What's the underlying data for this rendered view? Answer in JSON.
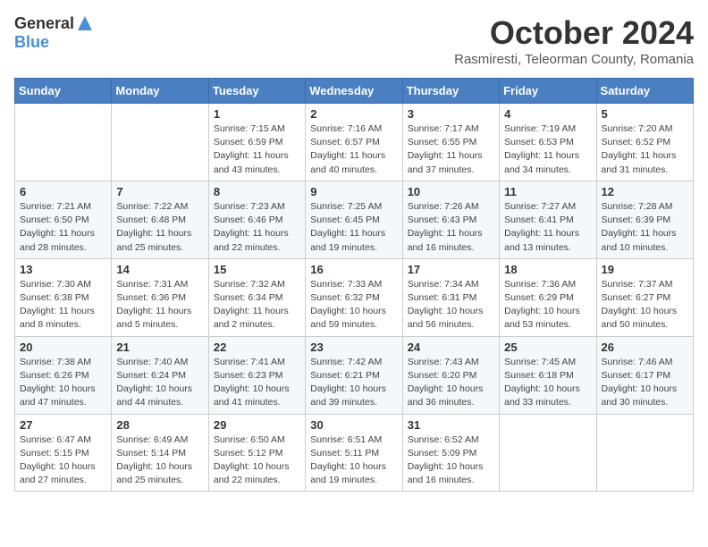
{
  "logo": {
    "general": "General",
    "blue": "Blue"
  },
  "title": "October 2024",
  "location": "Rasmiresti, Teleorman County, Romania",
  "weekdays": [
    "Sunday",
    "Monday",
    "Tuesday",
    "Wednesday",
    "Thursday",
    "Friday",
    "Saturday"
  ],
  "weeks": [
    [
      {
        "day": "",
        "detail": ""
      },
      {
        "day": "",
        "detail": ""
      },
      {
        "day": "1",
        "detail": "Sunrise: 7:15 AM\nSunset: 6:59 PM\nDaylight: 11 hours and 43 minutes."
      },
      {
        "day": "2",
        "detail": "Sunrise: 7:16 AM\nSunset: 6:57 PM\nDaylight: 11 hours and 40 minutes."
      },
      {
        "day": "3",
        "detail": "Sunrise: 7:17 AM\nSunset: 6:55 PM\nDaylight: 11 hours and 37 minutes."
      },
      {
        "day": "4",
        "detail": "Sunrise: 7:19 AM\nSunset: 6:53 PM\nDaylight: 11 hours and 34 minutes."
      },
      {
        "day": "5",
        "detail": "Sunrise: 7:20 AM\nSunset: 6:52 PM\nDaylight: 11 hours and 31 minutes."
      }
    ],
    [
      {
        "day": "6",
        "detail": "Sunrise: 7:21 AM\nSunset: 6:50 PM\nDaylight: 11 hours and 28 minutes."
      },
      {
        "day": "7",
        "detail": "Sunrise: 7:22 AM\nSunset: 6:48 PM\nDaylight: 11 hours and 25 minutes."
      },
      {
        "day": "8",
        "detail": "Sunrise: 7:23 AM\nSunset: 6:46 PM\nDaylight: 11 hours and 22 minutes."
      },
      {
        "day": "9",
        "detail": "Sunrise: 7:25 AM\nSunset: 6:45 PM\nDaylight: 11 hours and 19 minutes."
      },
      {
        "day": "10",
        "detail": "Sunrise: 7:26 AM\nSunset: 6:43 PM\nDaylight: 11 hours and 16 minutes."
      },
      {
        "day": "11",
        "detail": "Sunrise: 7:27 AM\nSunset: 6:41 PM\nDaylight: 11 hours and 13 minutes."
      },
      {
        "day": "12",
        "detail": "Sunrise: 7:28 AM\nSunset: 6:39 PM\nDaylight: 11 hours and 10 minutes."
      }
    ],
    [
      {
        "day": "13",
        "detail": "Sunrise: 7:30 AM\nSunset: 6:38 PM\nDaylight: 11 hours and 8 minutes."
      },
      {
        "day": "14",
        "detail": "Sunrise: 7:31 AM\nSunset: 6:36 PM\nDaylight: 11 hours and 5 minutes."
      },
      {
        "day": "15",
        "detail": "Sunrise: 7:32 AM\nSunset: 6:34 PM\nDaylight: 11 hours and 2 minutes."
      },
      {
        "day": "16",
        "detail": "Sunrise: 7:33 AM\nSunset: 6:32 PM\nDaylight: 10 hours and 59 minutes."
      },
      {
        "day": "17",
        "detail": "Sunrise: 7:34 AM\nSunset: 6:31 PM\nDaylight: 10 hours and 56 minutes."
      },
      {
        "day": "18",
        "detail": "Sunrise: 7:36 AM\nSunset: 6:29 PM\nDaylight: 10 hours and 53 minutes."
      },
      {
        "day": "19",
        "detail": "Sunrise: 7:37 AM\nSunset: 6:27 PM\nDaylight: 10 hours and 50 minutes."
      }
    ],
    [
      {
        "day": "20",
        "detail": "Sunrise: 7:38 AM\nSunset: 6:26 PM\nDaylight: 10 hours and 47 minutes."
      },
      {
        "day": "21",
        "detail": "Sunrise: 7:40 AM\nSunset: 6:24 PM\nDaylight: 10 hours and 44 minutes."
      },
      {
        "day": "22",
        "detail": "Sunrise: 7:41 AM\nSunset: 6:23 PM\nDaylight: 10 hours and 41 minutes."
      },
      {
        "day": "23",
        "detail": "Sunrise: 7:42 AM\nSunset: 6:21 PM\nDaylight: 10 hours and 39 minutes."
      },
      {
        "day": "24",
        "detail": "Sunrise: 7:43 AM\nSunset: 6:20 PM\nDaylight: 10 hours and 36 minutes."
      },
      {
        "day": "25",
        "detail": "Sunrise: 7:45 AM\nSunset: 6:18 PM\nDaylight: 10 hours and 33 minutes."
      },
      {
        "day": "26",
        "detail": "Sunrise: 7:46 AM\nSunset: 6:17 PM\nDaylight: 10 hours and 30 minutes."
      }
    ],
    [
      {
        "day": "27",
        "detail": "Sunrise: 6:47 AM\nSunset: 5:15 PM\nDaylight: 10 hours and 27 minutes."
      },
      {
        "day": "28",
        "detail": "Sunrise: 6:49 AM\nSunset: 5:14 PM\nDaylight: 10 hours and 25 minutes."
      },
      {
        "day": "29",
        "detail": "Sunrise: 6:50 AM\nSunset: 5:12 PM\nDaylight: 10 hours and 22 minutes."
      },
      {
        "day": "30",
        "detail": "Sunrise: 6:51 AM\nSunset: 5:11 PM\nDaylight: 10 hours and 19 minutes."
      },
      {
        "day": "31",
        "detail": "Sunrise: 6:52 AM\nSunset: 5:09 PM\nDaylight: 10 hours and 16 minutes."
      },
      {
        "day": "",
        "detail": ""
      },
      {
        "day": "",
        "detail": ""
      }
    ]
  ]
}
